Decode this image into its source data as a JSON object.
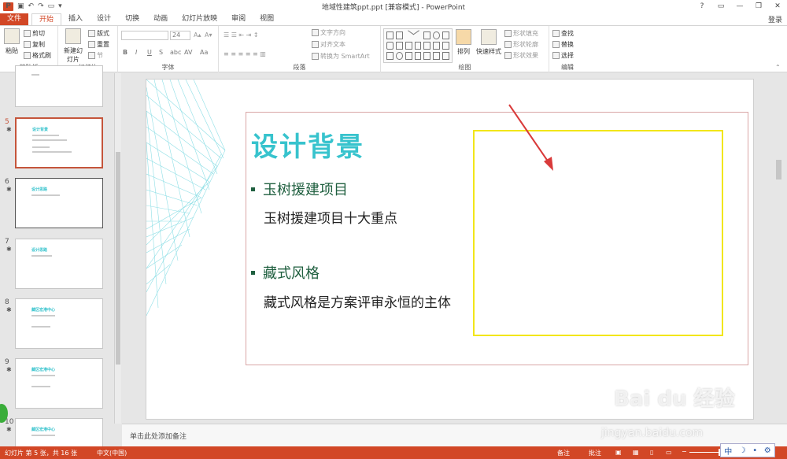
{
  "window": {
    "title": "地域性建筑ppt.ppt [兼容模式] - PowerPoint",
    "controls": [
      "?",
      "▭",
      "—",
      "❐",
      "✕"
    ]
  },
  "ribbon_tabs": [
    "文件",
    "开始",
    "插入",
    "设计",
    "切换",
    "动画",
    "幻灯片放映",
    "审阅",
    "视图"
  ],
  "login": "登录",
  "clipboard": {
    "paste": "粘贴",
    "cut": "剪切",
    "copy": "复制",
    "format_painter": "格式刷",
    "label": "剪贴板"
  },
  "slides_group": {
    "new_slide": "新建幻灯片",
    "layout": "版式",
    "reset": "重置",
    "section": "节",
    "label": "幻灯片"
  },
  "font_group": {
    "size": "24",
    "bold": "B",
    "italic": "I",
    "underline": "U",
    "strike": "S",
    "char_spacing": "AV",
    "case": "Aa",
    "label": "字体"
  },
  "paragraph_group": {
    "text_direction": "文字方向",
    "align_text": "对齐文本",
    "smartart": "转换为 SmartArt",
    "label": "段落"
  },
  "drawing_group": {
    "arrange": "排列",
    "quick_styles": "快速样式",
    "shape_fill": "形状填充",
    "shape_outline": "形状轮廓",
    "shape_effects": "形状效果",
    "label": "绘图"
  },
  "editing_group": {
    "find": "查找",
    "replace": "替换",
    "select": "选择",
    "label": "编辑"
  },
  "thumbnails": [
    {
      "num": "5",
      "title": "设计背景"
    },
    {
      "num": "6",
      "title": "设计思路"
    },
    {
      "num": "7",
      "title": "设计思路"
    },
    {
      "num": "8",
      "title": "藏区宏港中心"
    },
    {
      "num": "9",
      "title": "藏区宏港中心"
    },
    {
      "num": "10",
      "title": "藏区宏港中心"
    }
  ],
  "slide": {
    "title": "设计背景",
    "bullet1": "玉树援建项目",
    "sub1": "玉树援建项目十大重点",
    "bullet2": "藏式风格",
    "sub2": "藏式风格是方案评审永恒的主体"
  },
  "notes_placeholder": "单击此处添加备注",
  "status": {
    "slide_info": "幻灯片 第 5 张，共 16 张",
    "language": "中文(中国)",
    "notes": "备注",
    "comments": "批注"
  },
  "ime": {
    "mode": "中"
  },
  "watermark": {
    "brand": "Bai du 经验",
    "url": "jingyan.baidu.com"
  },
  "colors": {
    "accent": "#d24726",
    "slide_title": "#37c3cd",
    "bullet": "#1f5f3f",
    "placeholder_border": "#f2e619",
    "arrow": "#d93a3a"
  }
}
